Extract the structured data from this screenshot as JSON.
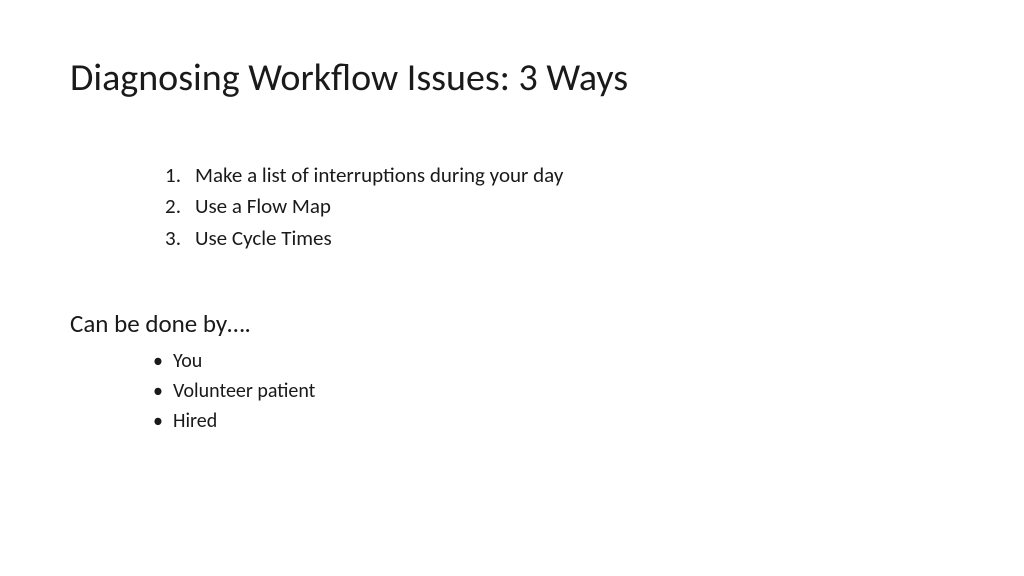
{
  "title": "Diagnosing Workflow Issues: 3 Ways",
  "numbered": [
    "Make a list of interruptions during your day",
    "Use a Flow Map",
    "Use Cycle Times"
  ],
  "subhead": "Can be done by….",
  "bullets": [
    "You",
    "Volunteer patient",
    "Hired"
  ]
}
